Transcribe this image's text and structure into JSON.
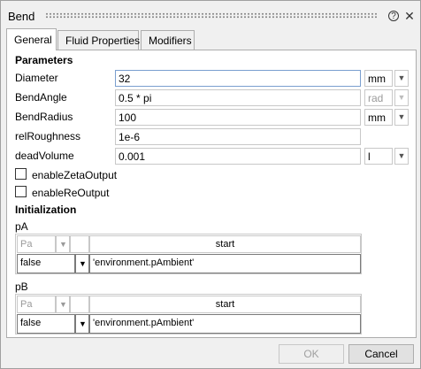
{
  "window": {
    "title": "Bend",
    "help_glyph": "?",
    "close_glyph": "✕"
  },
  "tabs": [
    {
      "label": "General",
      "active": true
    },
    {
      "label": "Fluid Properties",
      "active": false
    },
    {
      "label": "Modifiers",
      "active": false
    }
  ],
  "parameters": {
    "heading": "Parameters",
    "diameter": {
      "label": "Diameter",
      "value": "32",
      "unit": "mm"
    },
    "bend_angle": {
      "label": "BendAngle",
      "value": "0.5 * pi",
      "unit": "rad"
    },
    "bend_radius": {
      "label": "BendRadius",
      "value": "100",
      "unit": "mm"
    },
    "rel_roughness": {
      "label": "relRoughness",
      "value": "1e-6"
    },
    "dead_volume": {
      "label": "deadVolume",
      "value": "0.001",
      "unit": "l"
    },
    "enable_zeta": {
      "label": "enableZetaOutput",
      "checked": false
    },
    "enable_re": {
      "label": "enableReOutput",
      "checked": false
    }
  },
  "initialization": {
    "heading": "Initialization",
    "pA": {
      "label": "pA",
      "unit_placeholder": "Pa",
      "column_header": "start",
      "row_select": "false",
      "row_value": "'environment.pAmbient'"
    },
    "pB": {
      "label": "pB",
      "unit_placeholder": "Pa",
      "column_header": "start",
      "row_select": "false",
      "row_value": "'environment.pAmbient'"
    }
  },
  "buttons": {
    "ok_label": "OK",
    "cancel_label": "Cancel"
  },
  "icons": {
    "dropdown": "chevron-down-icon",
    "help": "help-icon",
    "close": "close-icon"
  },
  "colors": {
    "focus_border": "#7a9fcf",
    "panel_bg": "#ffffff",
    "window_bg": "#f0f0f0"
  }
}
